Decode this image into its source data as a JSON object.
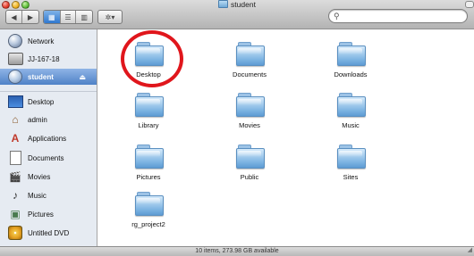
{
  "window": {
    "title": "student",
    "status": "10 items, 273.98 GB available"
  },
  "toolbar": {
    "back_glyph": "◀",
    "forward_glyph": "▶",
    "view_icons_glyph": "▦",
    "view_list_glyph": "☰",
    "view_columns_glyph": "▥",
    "action_glyph": "✲▾",
    "search_glyph": "⚲",
    "search_value": "",
    "search_placeholder": ""
  },
  "sidebar": {
    "devices": [
      {
        "label": "Network",
        "icon": "network-globe-icon"
      },
      {
        "label": "JJ-167-18",
        "icon": "hard-drive-icon"
      },
      {
        "label": "student",
        "icon": "home-volume-icon",
        "selected": true,
        "eject": "⏏"
      }
    ],
    "places": [
      {
        "label": "Desktop",
        "icon": "desktop-icon"
      },
      {
        "label": "admin",
        "icon": "home-icon",
        "glyph": "⌂"
      },
      {
        "label": "Applications",
        "icon": "applications-icon",
        "glyph": "A"
      },
      {
        "label": "Documents",
        "icon": "documents-icon"
      },
      {
        "label": "Movies",
        "icon": "movies-icon",
        "glyph": "🎬"
      },
      {
        "label": "Music",
        "icon": "music-icon",
        "glyph": "♪"
      },
      {
        "label": "Pictures",
        "icon": "pictures-icon",
        "glyph": "▣"
      },
      {
        "label": "Untitled DVD",
        "icon": "dvd-icon"
      }
    ]
  },
  "folders": [
    {
      "name": "Desktop"
    },
    {
      "name": "Documents"
    },
    {
      "name": "Downloads"
    },
    {
      "name": "Library"
    },
    {
      "name": "Movies"
    },
    {
      "name": "Music"
    },
    {
      "name": "Pictures"
    },
    {
      "name": "Public"
    },
    {
      "name": "Sites"
    },
    {
      "name": "rg_project2"
    }
  ],
  "annotation": {
    "color": "#e0161c",
    "target": "Desktop"
  }
}
